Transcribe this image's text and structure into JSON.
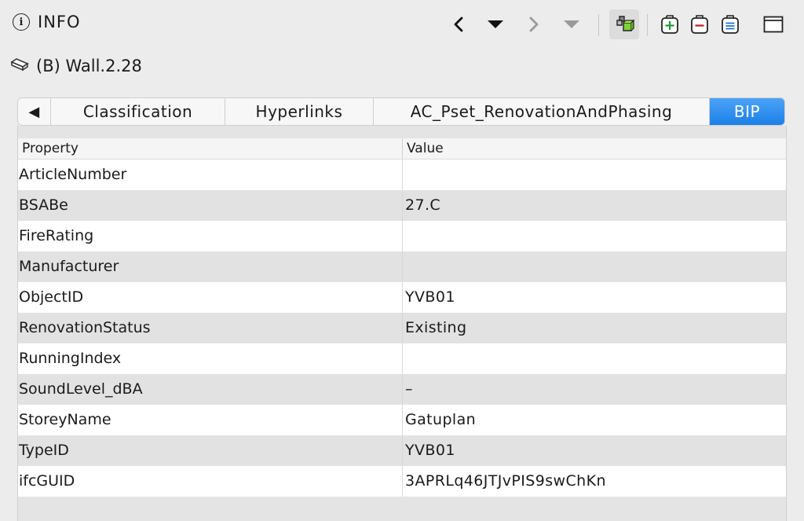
{
  "header": {
    "title": "INFO",
    "icon": "info-circle-icon"
  },
  "toolbar": {
    "items": [
      {
        "name": "back-arrow-icon"
      },
      {
        "name": "history-dropdown-icon"
      },
      {
        "name": "forward-arrow-icon"
      },
      {
        "name": "forward-dropdown-icon"
      },
      {
        "name": "highlight-object-icon",
        "active": true
      },
      {
        "name": "add-property-icon"
      },
      {
        "name": "remove-property-icon"
      },
      {
        "name": "list-properties-icon"
      },
      {
        "name": "window-icon"
      }
    ]
  },
  "object": {
    "name": "(B) Wall.2.28",
    "icon": "wall-object-icon"
  },
  "tabs": {
    "scroll_label": "◀",
    "items": [
      "Classification",
      "Hyperlinks",
      "AC_Pset_RenovationAndPhasing",
      "BIP"
    ],
    "selected": "BIP"
  },
  "table": {
    "columns": [
      "Property",
      "Value"
    ],
    "rows": [
      {
        "property": "ArticleNumber",
        "value": ""
      },
      {
        "property": "BSABe",
        "value": "27.C"
      },
      {
        "property": "FireRating",
        "value": ""
      },
      {
        "property": "Manufacturer",
        "value": ""
      },
      {
        "property": "ObjectID",
        "value": "YVB01"
      },
      {
        "property": "RenovationStatus",
        "value": "Existing"
      },
      {
        "property": "RunningIndex",
        "value": ""
      },
      {
        "property": "SoundLevel_dBA",
        "value": "–"
      },
      {
        "property": "StoreyName",
        "value": "Gatuplan"
      },
      {
        "property": "TypeID",
        "value": "YVB01"
      },
      {
        "property": "ifcGUID",
        "value": "3APRLq46JTJvPIS9swChKn"
      }
    ]
  },
  "colors": {
    "selected_tab": "#1c7fe8",
    "add_green": "#1e9a3c",
    "remove_red": "#c0282d",
    "list_blue": "#1f6fd1"
  }
}
